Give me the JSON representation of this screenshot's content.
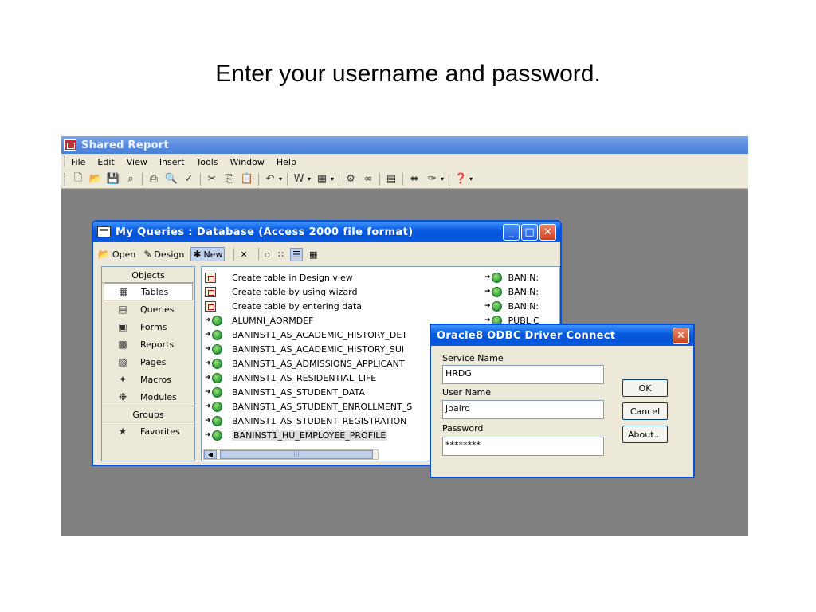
{
  "slide": {
    "title": "Enter your username and password."
  },
  "app": {
    "title": "Shared Report",
    "menu": [
      "File",
      "Edit",
      "View",
      "Insert",
      "Tools",
      "Window",
      "Help"
    ]
  },
  "db_window": {
    "title": "My Queries : Database (Access 2000 file format)",
    "toolbar": {
      "open": "Open",
      "design": "Design",
      "new": "New"
    },
    "objects_header": "Objects",
    "objects": [
      "Tables",
      "Queries",
      "Forms",
      "Reports",
      "Pages",
      "Macros",
      "Modules"
    ],
    "groups_header": "Groups",
    "groups": [
      "Favorites"
    ],
    "list": [
      "Create table in Design view",
      "Create table by using wizard",
      "Create table by entering data",
      "ALUMNI_AORMDEF",
      "BANINST1_AS_ACADEMIC_HISTORY_DET",
      "BANINST1_AS_ACADEMIC_HISTORY_SUI",
      "BANINST1_AS_ADMISSIONS_APPLICANT",
      "BANINST1_AS_RESIDENTIAL_LIFE",
      "BANINST1_AS_STUDENT_DATA",
      "BANINST1_AS_STUDENT_ENROLLMENT_S",
      "BANINST1_AS_STUDENT_REGISTRATION",
      "BANINST1_HU_EMPLOYEE_PROFILE"
    ],
    "right_list": [
      "BANIN:",
      "BANIN:",
      "BANIN:",
      "PUBLIC"
    ]
  },
  "dialog": {
    "title": "Oracle8 ODBC Driver Connect",
    "service_name_label": "Service Name",
    "service_name_value": "HRDG",
    "user_name_label": "User Name",
    "user_name_value": "jbaird",
    "password_label": "Password",
    "password_value": "********",
    "ok": "OK",
    "cancel": "Cancel",
    "about": "About..."
  }
}
